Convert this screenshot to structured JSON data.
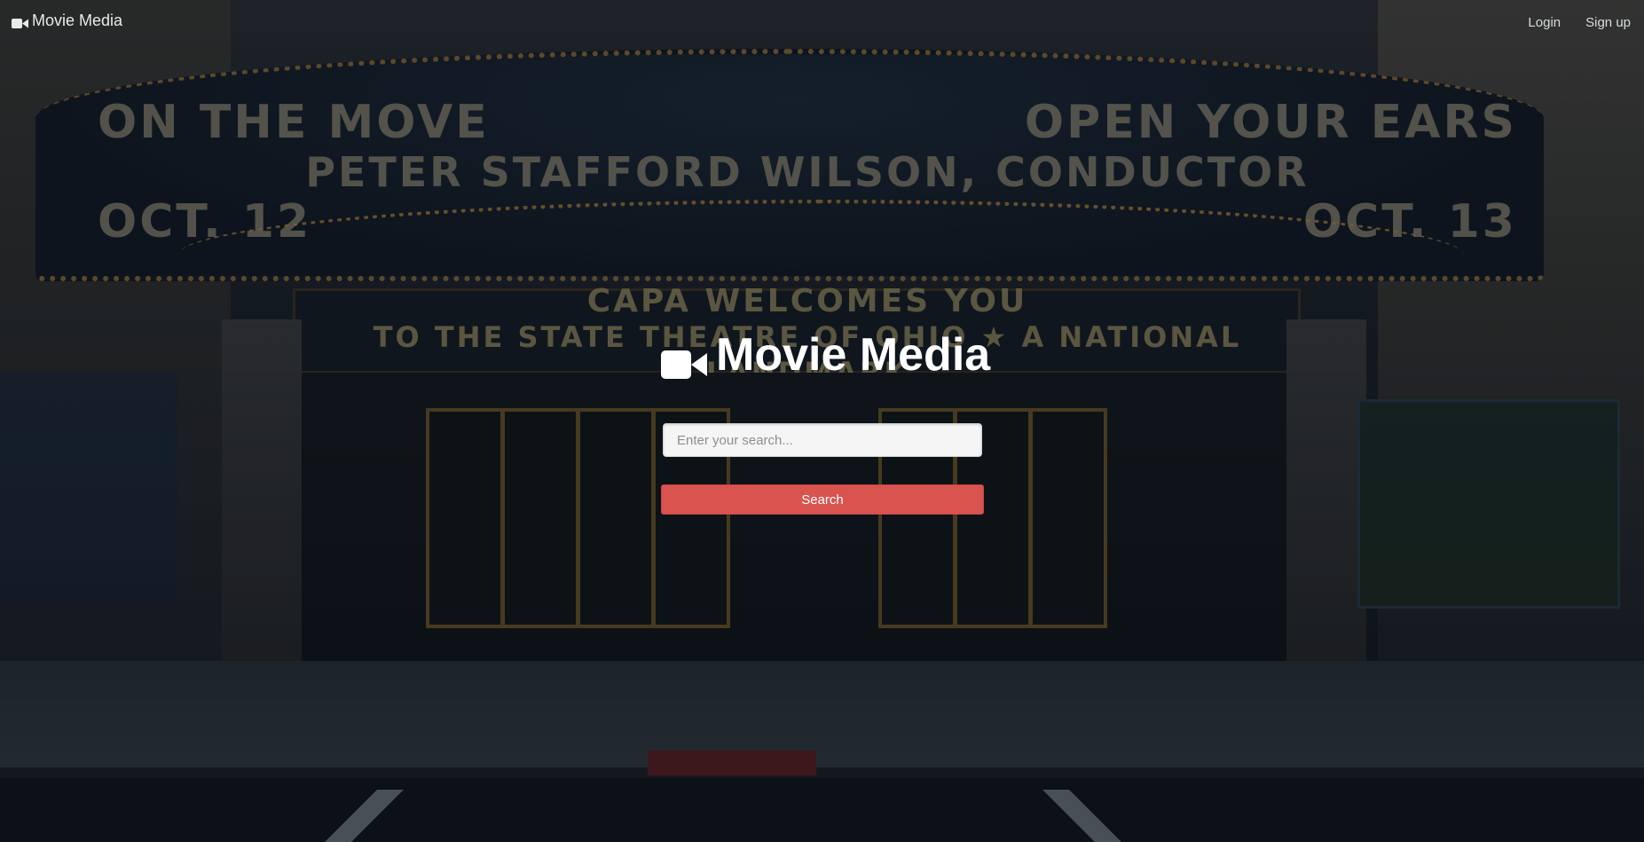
{
  "navbar": {
    "brand_icon": "video-camera-icon",
    "brand_label": "Movie Media",
    "login_label": "Login",
    "signup_label": "Sign up"
  },
  "hero": {
    "icon": "video-camera-icon",
    "title": "Movie Media",
    "search": {
      "value": "",
      "placeholder": "Enter your search..."
    },
    "search_button_label": "Search"
  },
  "background": {
    "marquee_line1_left": "ON THE MOVE",
    "marquee_line2_left": "OCT. 12",
    "marquee_middle": "PETER STAFFORD WILSON, CONDUCTOR",
    "marquee_line1_right": "OPEN YOUR EARS",
    "marquee_line2_right": "OCT. 13",
    "sign_line1": "CAPA WELCOMES YOU",
    "sign_line2": "TO THE STATE THEATRE OF OHIO ★ A NATIONAL LANDMARK"
  },
  "colors": {
    "search_button": "#d9534f",
    "title_text": "#ffffff"
  }
}
